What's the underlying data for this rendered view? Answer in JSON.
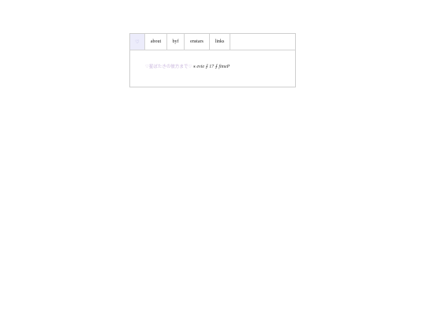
{
  "nav": {
    "home_icon": "♡",
    "home_icon_name": "heart-icon",
    "tabs": [
      {
        "label": "about"
      },
      {
        "label": "byf"
      },
      {
        "label": "enstars"
      },
      {
        "label": "links"
      }
    ]
  },
  "intro": {
    "tagline": "♡星ぼたきの彼方まで♡",
    "name": "evie",
    "sep1": "⨍",
    "age": "17",
    "sep2": "⨍",
    "pronouns": "fimeP"
  },
  "colors": {
    "accent_bg": "#ececfb",
    "accent_text": "#a9a4d9",
    "tagline": "#cbb8de",
    "border": "#cfcfcf"
  }
}
